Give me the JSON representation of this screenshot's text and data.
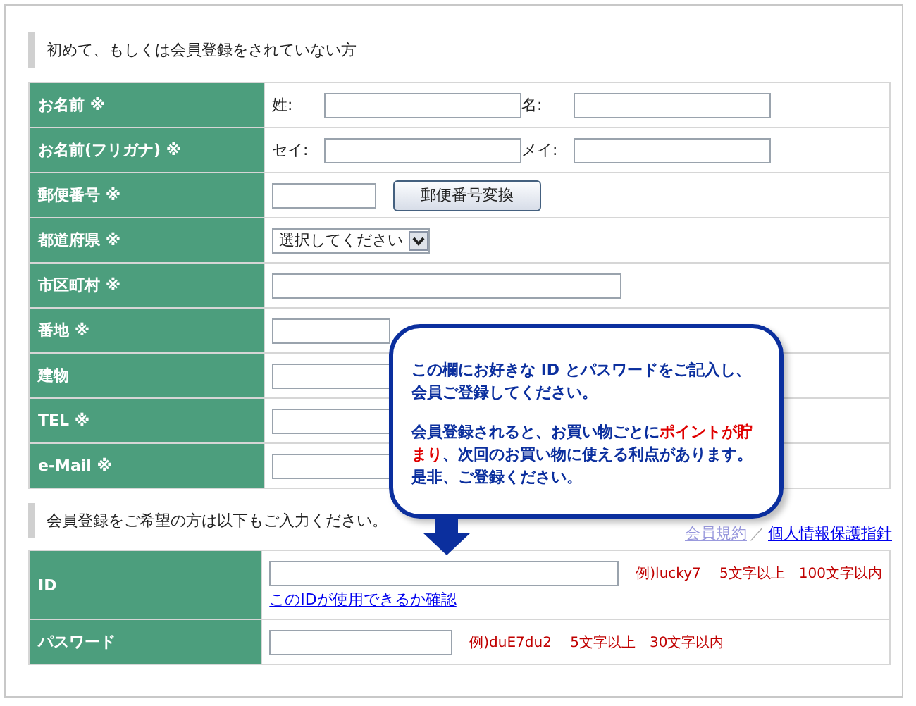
{
  "section_heading": "初めて、もしくは会員登録をされていない方",
  "form_rows": [
    {
      "kind": "pair",
      "label": "お名前 ※",
      "fields": [
        {
          "label": "姓:"
        },
        {
          "label": "名:"
        }
      ]
    },
    {
      "kind": "pair",
      "label": "お名前(フリガナ) ※",
      "fields": [
        {
          "label": "セイ:"
        },
        {
          "label": "メイ:"
        }
      ]
    },
    {
      "kind": "postal",
      "label": "郵便番号 ※",
      "button": "郵便番号変換"
    },
    {
      "kind": "select",
      "label": "都道府県 ※",
      "value": "選択してください"
    },
    {
      "kind": "text",
      "label": "市区町村 ※",
      "covered": false
    },
    {
      "kind": "text",
      "label": "番地 ※",
      "covered": true
    },
    {
      "kind": "text",
      "label": "建物",
      "covered": true
    },
    {
      "kind": "text",
      "label": "TEL ※",
      "covered": true
    },
    {
      "kind": "text",
      "label": "e-Mail ※",
      "covered": true
    }
  ],
  "member_heading": "会員登録をご希望の方は以下もご入力ください。",
  "links": [
    "会員規約",
    "個人情報保護指針"
  ],
  "link_separator": "／",
  "member_rows": [
    {
      "kind": "id",
      "label": "ID",
      "hint": "例)lucky7　 5文字以上　100文字以内",
      "link": "このIDが使用できるか確認"
    },
    {
      "kind": "password",
      "label": "パスワード",
      "hint": "例)duE7du2　 5文字以上　30文字以内"
    }
  ],
  "callout": {
    "paragraphs": [
      "この欄にお好きな ID とパスワードをご記入し、会員ご登録してください。",
      "会員登録されると、お買い物ごとに**ポイントが貯まり**、次回のお買い物に使える利点があります。是非、ご登録ください。"
    ]
  }
}
